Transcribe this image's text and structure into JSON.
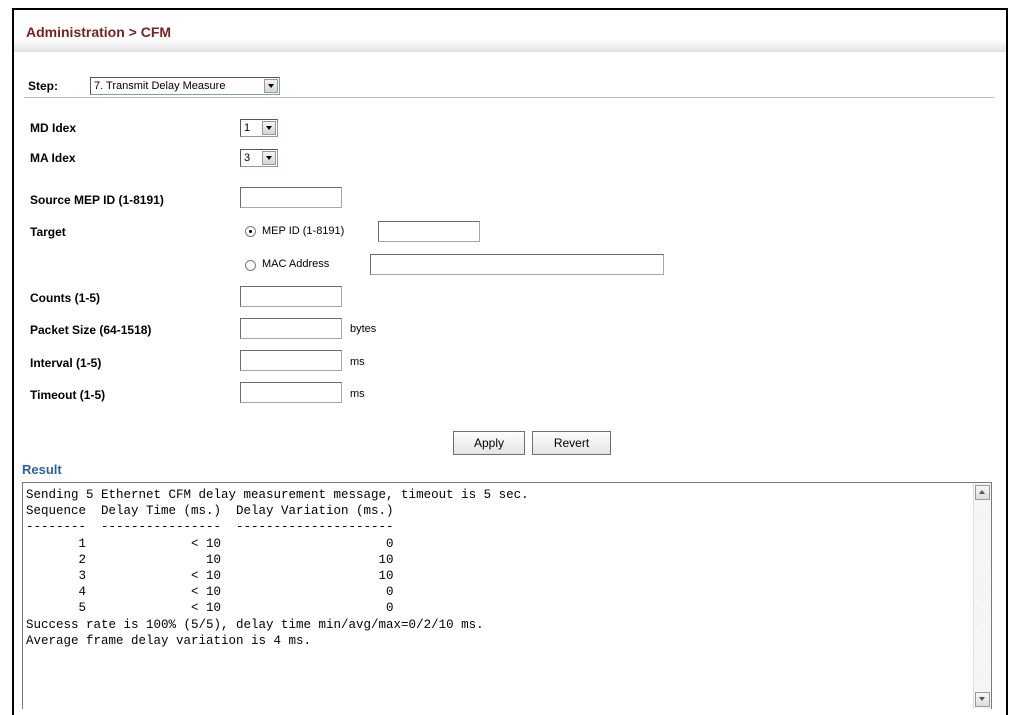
{
  "header": {
    "title": "Administration > CFM"
  },
  "step": {
    "label": "Step:",
    "selected": "7. Transmit Delay Measure"
  },
  "form": {
    "md_index": {
      "label": "MD Idex",
      "selected": "1"
    },
    "ma_index": {
      "label": "MA Idex",
      "selected": "3"
    },
    "source_mep": {
      "label": "Source MEP ID (1-8191)",
      "value": ""
    },
    "target": {
      "label": "Target",
      "mep_option": "MEP ID (1-8191)",
      "mac_option": "MAC Address",
      "mep_value": "",
      "mac_value": "",
      "selected": "mep"
    },
    "counts": {
      "label": "Counts (1-5)",
      "value": ""
    },
    "packet_size": {
      "label": "Packet Size (64-1518)",
      "value": "",
      "unit": "bytes"
    },
    "interval": {
      "label": "Interval (1-5)",
      "value": "",
      "unit": "ms"
    },
    "timeout": {
      "label": "Timeout (1-5)",
      "value": "",
      "unit": "ms"
    }
  },
  "buttons": {
    "apply": "Apply",
    "revert": "Revert"
  },
  "result": {
    "label": "Result",
    "text": "Sending 5 Ethernet CFM delay measurement message, timeout is 5 sec.\nSequence  Delay Time (ms.)  Delay Variation (ms.)\n--------  ----------------  ---------------------\n       1              < 10                      0\n       2                10                     10\n       3              < 10                     10\n       4              < 10                      0\n       5              < 10                      0\nSuccess rate is 100% (5/5), delay time min/avg/max=0/2/10 ms.\nAverage frame delay variation is 4 ms."
  }
}
